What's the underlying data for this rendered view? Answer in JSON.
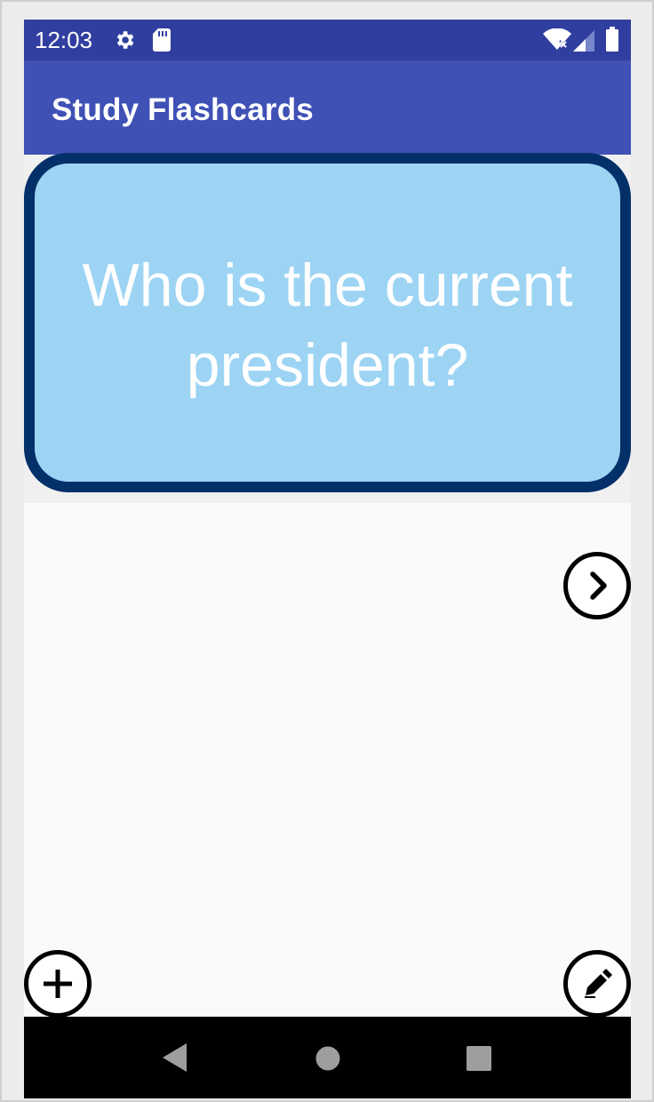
{
  "status_bar": {
    "time": "12:03",
    "background": "#303f9f",
    "icons": [
      "gear-icon",
      "sd-card-icon",
      "wifi-no-internet-icon",
      "cell-signal-icon",
      "battery-icon"
    ]
  },
  "app_bar": {
    "title": "Study Flashcards",
    "background": "#3f51b5"
  },
  "flashcard": {
    "question": "Who is the current president?",
    "fill": "#9dd4f4",
    "border": "#04306a"
  },
  "actions": {
    "next": "chevron-right-icon",
    "add": "plus-icon",
    "edit": "pencil-icon"
  },
  "nav_bar": {
    "icons": [
      "back-triangle-icon",
      "home-circle-icon",
      "recents-square-icon"
    ]
  }
}
